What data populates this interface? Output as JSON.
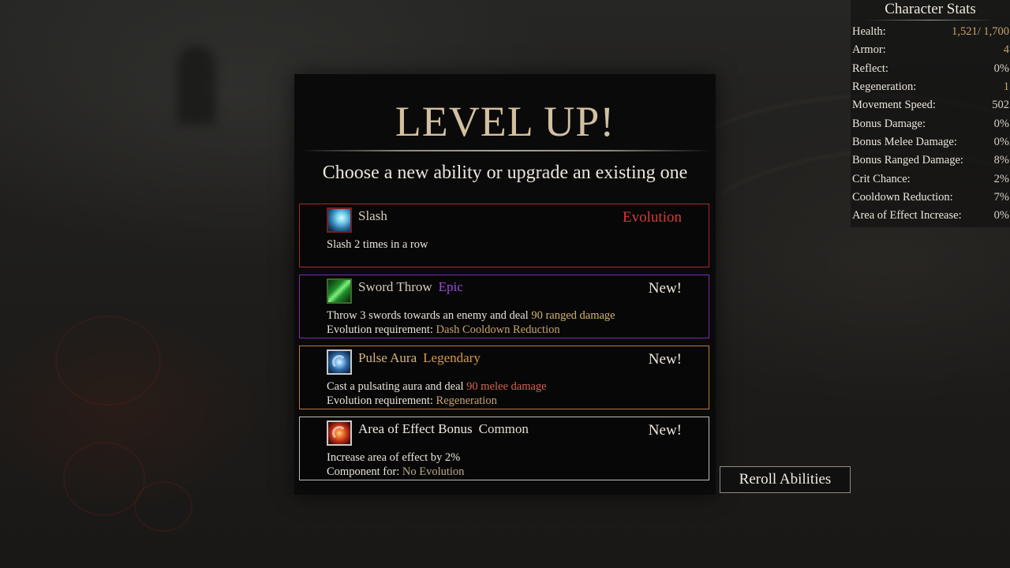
{
  "level_up": {
    "title": "LEVEL UP!",
    "subtitle": "Choose a new ability or upgrade an existing one",
    "cards": [
      {
        "name": "Slash",
        "rarity": "",
        "tag": "Evolution",
        "tag_color": "#d33a34",
        "icon": "slash-icon",
        "desc_line1": {
          "text": "Slash 2 times in a row",
          "highlight": ""
        },
        "desc_line2": {
          "label": "",
          "value": ""
        }
      },
      {
        "name": "Sword Throw",
        "rarity": "Epic",
        "rarity_color": "#9b4be0",
        "tag": "New!",
        "icon": "sword-throw-icon",
        "desc_line1": {
          "text": "Throw 3 swords towards an enemy and deal ",
          "highlight": "90 ranged damage"
        },
        "desc_line2": {
          "label": "Evolution requirement: ",
          "value": "Dash Cooldown Reduction"
        }
      },
      {
        "name": "Pulse Aura",
        "rarity": "Legendary",
        "rarity_color": "#d79a3c",
        "tag": "New!",
        "icon": "pulse-aura-icon",
        "desc_line1": {
          "text": "Cast a pulsating aura and deal ",
          "highlight": "90 melee damage"
        },
        "desc_line2": {
          "label": "Evolution requirement: ",
          "value": "Regeneration"
        }
      },
      {
        "name": "Area of Effect Bonus",
        "rarity": "Common",
        "rarity_color": "#e0dbd0",
        "tag": "New!",
        "icon": "area-of-effect-icon",
        "desc_line1": {
          "text": "Increase area of effect by 2%",
          "highlight": ""
        },
        "desc_line2": {
          "label": "Component for: ",
          "value": "No Evolution"
        }
      }
    ],
    "reroll_label": "Reroll Abilities"
  },
  "stats": {
    "title": "Character Stats",
    "rows": [
      {
        "label": "Health:",
        "value": "1,521/ 1,700"
      },
      {
        "label": "Armor:",
        "value": "4"
      },
      {
        "label": "Reflect:",
        "value": "0%"
      },
      {
        "label": "Regeneration:",
        "value": "1"
      },
      {
        "label": "Movement Speed:",
        "value": "502"
      },
      {
        "label": "Bonus Damage:",
        "value": "0%"
      },
      {
        "label": "Bonus Melee Damage:",
        "value": "0%"
      },
      {
        "label": "Bonus Ranged Damage:",
        "value": "8%"
      },
      {
        "label": "Crit Chance:",
        "value": "2%"
      },
      {
        "label": "Cooldown Reduction:",
        "value": "7%"
      },
      {
        "label": "Area of Effect Increase:",
        "value": "0%"
      }
    ]
  }
}
